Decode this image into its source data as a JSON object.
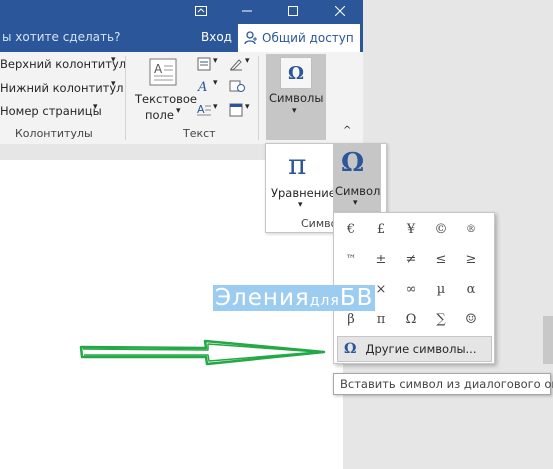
{
  "titlebar": {
    "restore_icon": "restore-ribbon-icon",
    "maximize_icon": "maximize-icon",
    "close_icon": "close-icon"
  },
  "tellrow": {
    "tellme": "ы хотите сделать?",
    "login": "Вход",
    "share": "Общий доступ"
  },
  "ribbon": {
    "header_footer": {
      "header": "Верхний колонтитул",
      "footer": "Нижний колонтитул",
      "page_number": "Номер страницы",
      "group_label": "Колонтитулы"
    },
    "text": {
      "textbox_line1": "Текстовое",
      "textbox_line2": "поле",
      "group_label": "Текст"
    },
    "symbols_button": "Символы"
  },
  "symbols_group": {
    "equation": "Уравнение",
    "symbol": "Символ",
    "group_label": "Символы"
  },
  "symbol_grid": [
    [
      "€",
      "£",
      "¥",
      "©",
      "®"
    ],
    [
      "™",
      "±",
      "≠",
      "≤",
      "≥"
    ],
    [
      "÷",
      "×",
      "∞",
      "µ",
      "α"
    ],
    [
      "β",
      "π",
      "Ω",
      "∑",
      "☺"
    ]
  ],
  "other_symbols": "Другие символы...",
  "tooltip": "Вставить символ из диалогового окна",
  "watermark": {
    "part1": "Элен",
    "part2": "ия",
    "part3": "для",
    "part4": "БВ"
  },
  "colors": {
    "title_blue": "#2b579a",
    "arrow_green": "#22a845"
  }
}
